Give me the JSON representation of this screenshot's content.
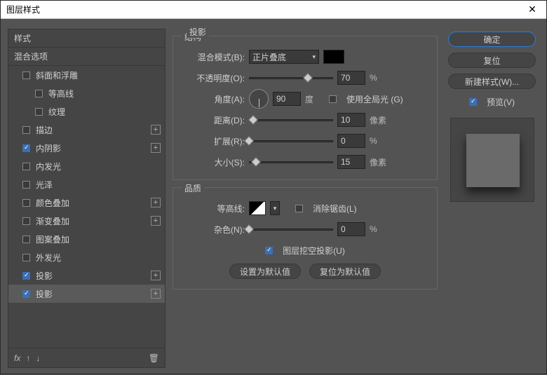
{
  "title": "图层样式",
  "leftPanel": {
    "header": "样式",
    "blendingOptions": "混合选项",
    "items": [
      {
        "label": "斜面和浮雕",
        "checked": false,
        "indent": 1,
        "add": false
      },
      {
        "label": "等高线",
        "checked": false,
        "indent": 2,
        "add": false
      },
      {
        "label": "纹理",
        "checked": false,
        "indent": 2,
        "add": false
      },
      {
        "label": "描边",
        "checked": false,
        "indent": 1,
        "add": true
      },
      {
        "label": "内阴影",
        "checked": true,
        "indent": 1,
        "add": true
      },
      {
        "label": "内发光",
        "checked": false,
        "indent": 1,
        "add": false
      },
      {
        "label": "光泽",
        "checked": false,
        "indent": 1,
        "add": false
      },
      {
        "label": "颜色叠加",
        "checked": false,
        "indent": 1,
        "add": true
      },
      {
        "label": "渐变叠加",
        "checked": false,
        "indent": 1,
        "add": true
      },
      {
        "label": "图案叠加",
        "checked": false,
        "indent": 1,
        "add": false
      },
      {
        "label": "外发光",
        "checked": false,
        "indent": 1,
        "add": false
      },
      {
        "label": "投影",
        "checked": true,
        "indent": 1,
        "add": true,
        "sel": false
      },
      {
        "label": "投影",
        "checked": true,
        "indent": 1,
        "add": true,
        "sel": true
      }
    ],
    "footer": {
      "fx": "fx"
    }
  },
  "center": {
    "panelTitle": "投影",
    "structTitle": "结构",
    "blendModeLabel": "混合模式(B):",
    "blendModeValue": "正片叠底",
    "opacityLabel": "不透明度(O):",
    "opacityValue": "70",
    "angleLabel": "角度(A):",
    "angleValue": "90",
    "degree": "度",
    "globalLight": "使用全局光 (G)",
    "distanceLabel": "距离(D):",
    "distanceValue": "10",
    "px": "像素",
    "spreadLabel": "扩展(R):",
    "spreadValue": "0",
    "sizeLabel": "大小(S):",
    "sizeValue": "15",
    "qualityTitle": "品质",
    "contourLabel": "等高线:",
    "antiAlias": "消除锯齿(L)",
    "noiseLabel": "杂色(N):",
    "noiseValue": "0",
    "knockout": "图层挖空投影(U)",
    "setDefault": "设置为默认值",
    "resetDefault": "复位为默认值",
    "percent": "%"
  },
  "right": {
    "ok": "确定",
    "reset": "复位",
    "newStyle": "新建样式(W)...",
    "preview": "预览(V)"
  }
}
